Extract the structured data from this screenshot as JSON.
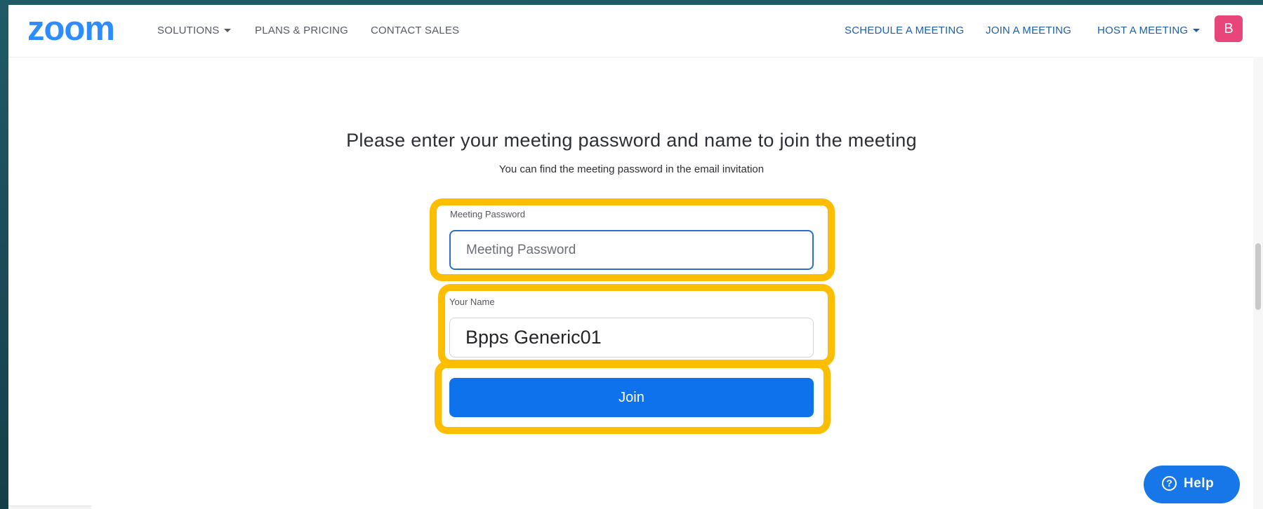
{
  "brand": {
    "logo_text": "zoom",
    "logo_color": "#2d8cff"
  },
  "nav": {
    "left": [
      {
        "label": "SOLUTIONS",
        "dropdown": true
      },
      {
        "label": "PLANS & PRICING",
        "dropdown": false
      },
      {
        "label": "CONTACT SALES",
        "dropdown": false
      }
    ],
    "right": [
      {
        "label": "SCHEDULE A MEETING",
        "dropdown": false
      },
      {
        "label": "JOIN A MEETING",
        "dropdown": false
      },
      {
        "label": "HOST A MEETING",
        "dropdown": true
      }
    ],
    "avatar_initial": "B",
    "avatar_color": "#e8457a"
  },
  "main": {
    "heading": "Please enter your meeting password and name to join the meeting",
    "subheading": "You can find the meeting password in the email invitation",
    "password": {
      "label": "Meeting Password",
      "placeholder": "Meeting Password",
      "value": ""
    },
    "name": {
      "label": "Your Name",
      "value": "Bpps Generic01"
    },
    "join_label": "Join",
    "join_color": "#0e72ed"
  },
  "help": {
    "label": "Help",
    "icon": "question-circle-icon"
  },
  "highlight_color": "#fdbd00"
}
